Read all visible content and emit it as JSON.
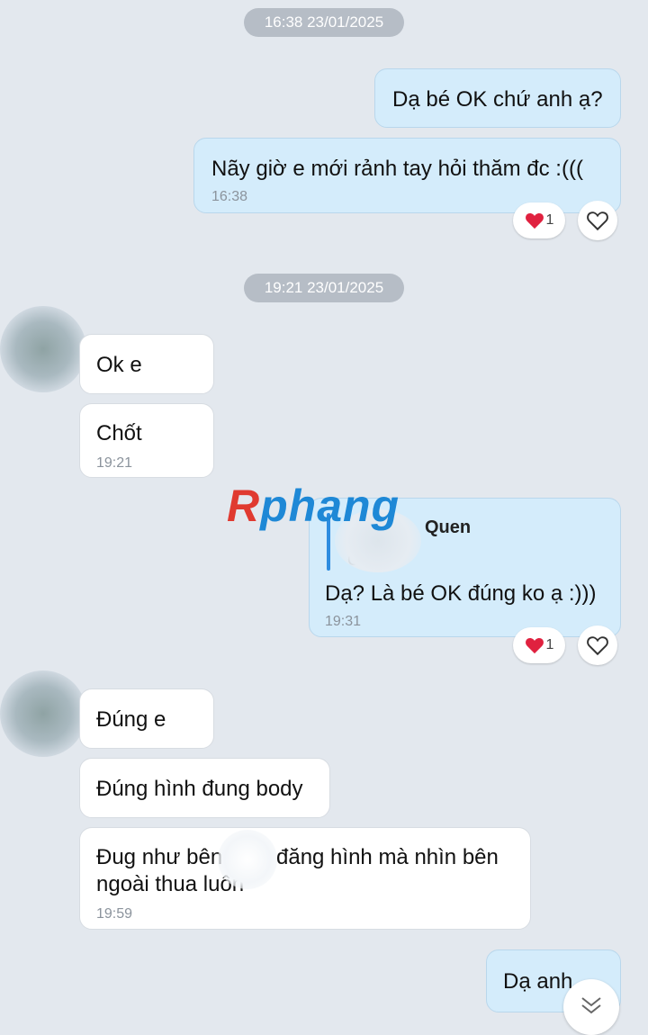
{
  "timestamps": [
    "16:38 23/01/2025",
    "19:21 23/01/2025"
  ],
  "messages": {
    "m1": {
      "text": "Dạ bé OK chứ anh ạ?"
    },
    "m2": {
      "text": "Nãy giờ e mới rảnh tay hỏi thăm đc :(((",
      "time": "16:38",
      "reaction_count": "1"
    },
    "m3": {
      "text": "Ok e"
    },
    "m4": {
      "text": "Chốt",
      "time": "19:21"
    },
    "m5": {
      "quote_name": "Quen",
      "quote_snippet": "Ch",
      "text": "Dạ? Là bé OK đúng ko ạ :)))",
      "time": "19:31",
      "reaction_count": "1"
    },
    "m6": {
      "text": "Đúng e"
    },
    "m7": {
      "text": "Đúng hình đung body"
    },
    "m8": {
      "line1_a": "Đug như bên",
      "line1_b": "đăng hình mà nhìn bên",
      "line2": "ngoài thua luôn",
      "time": "19:59"
    },
    "m9": {
      "text": "Dạ anh"
    }
  },
  "watermark": {
    "part1": "R",
    "part2": "phang"
  },
  "icons": {
    "reaction": "red-heart-icon",
    "react_button": "heart-outline-icon",
    "scroll": "chevron-down-icon"
  },
  "colors": {
    "background": "#e3e8ee",
    "outgoing_bubble": "#d4ecfb",
    "incoming_bubble": "#ffffff",
    "timestamp_pill": "#b6bdc6",
    "quote_bar": "#2d8ce0"
  }
}
